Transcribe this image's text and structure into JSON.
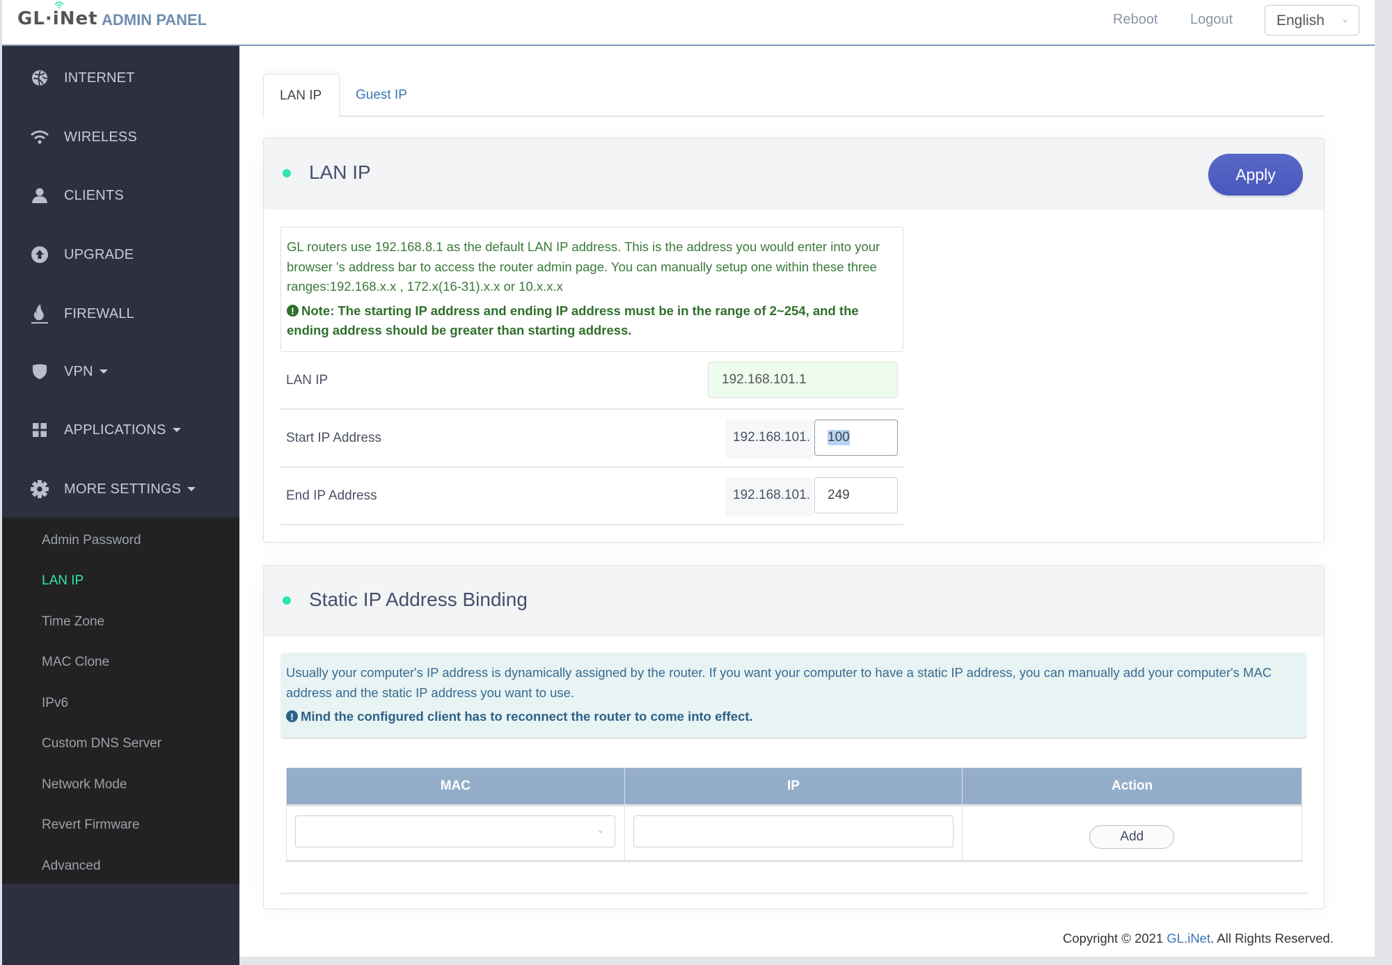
{
  "header": {
    "logo_text": "GL·iNet",
    "panel_title": "ADMIN PANEL",
    "links": {
      "reboot": "Reboot",
      "logout": "Logout"
    },
    "language": {
      "selected": "English",
      "icon": "chevron-down-icon"
    }
  },
  "sidebar": {
    "items": [
      {
        "label": "INTERNET",
        "icon": "globe-icon",
        "has_dropdown": false
      },
      {
        "label": "WIRELESS",
        "icon": "wifi-icon",
        "has_dropdown": false
      },
      {
        "label": "CLIENTS",
        "icon": "user-icon",
        "has_dropdown": false
      },
      {
        "label": "UPGRADE",
        "icon": "upload-arrow-icon",
        "has_dropdown": false
      },
      {
        "label": "FIREWALL",
        "icon": "fire-icon",
        "has_dropdown": false
      },
      {
        "label": "VPN",
        "icon": "shield-icon",
        "has_dropdown": true
      },
      {
        "label": "APPLICATIONS",
        "icon": "grid-icon",
        "has_dropdown": true
      },
      {
        "label": "MORE SETTINGS",
        "icon": "gear-icon",
        "has_dropdown": true
      }
    ],
    "submenu": [
      {
        "label": "Admin Password",
        "active": false
      },
      {
        "label": "LAN IP",
        "active": true
      },
      {
        "label": "Time Zone",
        "active": false
      },
      {
        "label": "MAC Clone",
        "active": false
      },
      {
        "label": "IPv6",
        "active": false
      },
      {
        "label": "Custom DNS Server",
        "active": false
      },
      {
        "label": "Network Mode",
        "active": false
      },
      {
        "label": "Revert Firmware",
        "active": false
      },
      {
        "label": "Advanced",
        "active": false
      }
    ]
  },
  "tabs": [
    {
      "label": "LAN IP",
      "active": true
    },
    {
      "label": "Guest IP",
      "active": false
    }
  ],
  "lan_card": {
    "title": "LAN IP",
    "apply_label": "Apply",
    "info_text": "GL routers use 192.168.8.1 as the default LAN IP address. This is the address you would enter into your browser 's address bar to access the router admin page. You can manually setup one within these three ranges:192.168.x.x , 172.x(16-31).x.x or 10.x.x.x",
    "note_text": "Note: The starting IP address and ending IP address must be in the range of 2~254, and the ending address should be greater than starting address.",
    "fields": {
      "lan_ip": {
        "label": "LAN IP",
        "value": "192.168.101.1"
      },
      "start_ip": {
        "label": "Start IP Address",
        "prefix": "192.168.101.",
        "value": "100"
      },
      "end_ip": {
        "label": "End IP Address",
        "prefix": "192.168.101.",
        "value": "249"
      }
    }
  },
  "static_card": {
    "title": "Static IP Address Binding",
    "info_text": "Usually your computer's IP address is dynamically assigned by the router. If you want your computer to have a static IP address, you can manually add your computer's MAC address and the static IP address you want to use.",
    "note_text": "Mind the configured client has to reconnect the router to come into effect.",
    "table": {
      "columns": [
        "MAC",
        "IP",
        "Action"
      ],
      "new_row": {
        "mac_value": "",
        "ip_value": "",
        "action_label": "Add"
      }
    }
  },
  "footer": {
    "prefix": "Copyright © 2021 ",
    "link": "GL.iNet",
    "suffix": ". All Rights Reserved."
  },
  "colors": {
    "sidebar_bg": "#2e303f",
    "submenu_bg": "#222222",
    "accent_green": "#2ee6b0",
    "apply_blue": "#5261c2",
    "table_header": "#94adc9",
    "link_blue": "#3b78b5",
    "info_green": "#3a7a38",
    "info_teal_bg": "#e8f3f4"
  }
}
